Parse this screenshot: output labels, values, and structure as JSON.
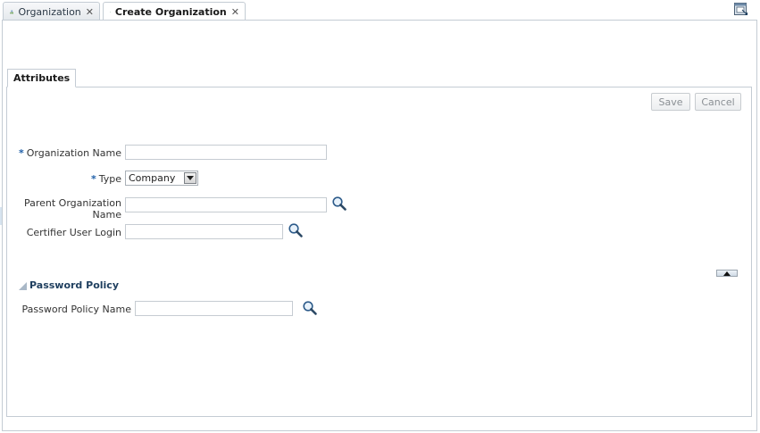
{
  "tabs": [
    {
      "label": "Organization",
      "close": "✕",
      "active": false
    },
    {
      "label": "Create Organization",
      "close": "✕",
      "active": true
    }
  ],
  "inner_tab": {
    "label": "Attributes"
  },
  "toolbar": {
    "save_label": "Save",
    "cancel_label": "Cancel"
  },
  "form": {
    "required_mark": "*",
    "org_name": {
      "label": "Organization Name",
      "value": ""
    },
    "type": {
      "label": "Type",
      "value": "Company"
    },
    "parent_org": {
      "label_line1": "Parent Organization",
      "label_line2": "Name",
      "value": ""
    },
    "certifier": {
      "label": "Certifier User Login",
      "value": ""
    }
  },
  "password_section": {
    "title": "Password Policy",
    "policy_name": {
      "label": "Password Policy Name",
      "value": ""
    }
  },
  "icons": {
    "org": "organization-icon",
    "search": "magnifier-icon",
    "maximize": "maximize-icon",
    "collapse": "triangle-up-icon"
  },
  "colors": {
    "required": "#1f5fa8",
    "section_title": "#1f3f5f",
    "border": "#c4ccd4"
  }
}
